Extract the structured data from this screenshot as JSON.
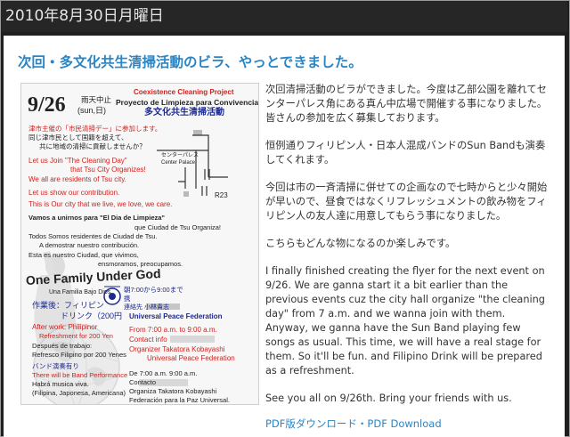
{
  "header": {
    "date": "2010年8月30日月曜日"
  },
  "post": {
    "title": "次回・多文化共生清掃活動のビラ、やっとできました。",
    "paragraphs": [
      "次回清掃活動のビラができました。今度は乙部公園を離れてセンターパレス角にある真ん中広場で開催する事になりました。皆さんの参加を広く募集しております。",
      "恒例通りフィリピン人・日本人混成バンドのSun Bandも演奏してくれます。",
      "今回は市の一斉清掃に併せての企画なので七時からと少々開始が早いので、昼食ではなくリフレッシュメントの飲み物をフィリピン人の友人達に用意してもらう事になりました。",
      "こちらもどんな物になるのか楽しみです。",
      "I finally finished creating the flyer for the next event on 9/26. We are ganna start it a bit earlier than the previous events cuz the city hall organize \"the cleaning day\" from 7 a.m. and we wanna join with them. Anyway, we ganna have the Sun Band playing few songs as usual. This time, we will have a real stage for them. So it'll be fun. and Filipino Drink will be prepared as a refreshment.",
      "See you all on 9/26th. Bring your friends with us."
    ],
    "download_link": "PDF版ダウンロード・PDF Download"
  },
  "flyer": {
    "date": "9/26",
    "rain": "雨天中止",
    "day": "(sun,日)",
    "project_en": "Coexistence Cleaning Project",
    "project_es": "Proyecto de Limpieza para Convivencia",
    "project_jp": "多文化共生清掃活動",
    "jp_intro": [
      "津市主催の「市民清掃デー」に参加します。",
      "同じ津市民として国籍を超えて、",
      "共に地域の清掃に貢献しませんか？"
    ],
    "en_intro": [
      "Let us Join \"The Cleaning Day\"",
      "that Tsu City Organizes!",
      "We all are residents of Tsu city.",
      "Let us show our contribution.",
      "This is Our city that we live, we love, we care."
    ],
    "es_intro": [
      "Vamos a unirnos para \"El Dia de Limpieza\"",
      "que Ciudad de Tsu Organiza!",
      "Todos Somos residentes de Ciudad de Tsu.",
      "A demostrar nuestro contribución.",
      "Esta es nuestro Ciudad, que vivimos,",
      "ensmoramos, preocupamos."
    ],
    "map": {
      "center_palace_jp": "センターパレス",
      "center_palace_en": "Center Palace",
      "route": "R23"
    },
    "slogan": "One Family Under God",
    "slogan_es": "Una Familia Bajo Dios",
    "time_jp": "朝7:00から9:00まで",
    "contact_jp": "携",
    "contact_name_jp": "連絡先 小林貴志",
    "upf": "Universal Peace Federation",
    "after_jp": "作業後：フィリピン",
    "drink_jp": "ドリンク（200円",
    "after_en": [
      "After work: Philipinor",
      "Refreshment for 200 Yen"
    ],
    "after_es": [
      "Después de trabajo:",
      "Refresco Filipino por 200 Yenes"
    ],
    "time_en": "From 7:00 a.m. to 9:00 a.m.",
    "contact_en": "Contact info",
    "organizer_en": [
      "Organizer Takatora Kobayashi",
      "Universal Peace Federation"
    ],
    "band_jp": "バンド演奏有り",
    "band_en": "There will be Band Performance",
    "band_es": [
      "Habrá musica viva.",
      "(Filipina, Japonesa, Americana)"
    ],
    "time_es": "De 7:00 a.m. 9:00 a.m.",
    "contact_es": "Contacto",
    "organizer_es": [
      "Organiza Takatora Kobayashi",
      "Federación para la Paz Universal."
    ]
  }
}
